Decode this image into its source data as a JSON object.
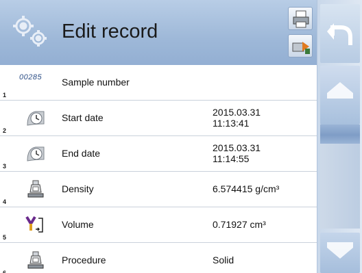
{
  "header": {
    "title": "Edit record"
  },
  "rows": [
    {
      "index": "1",
      "code": "00285",
      "label": "Sample number",
      "value": ""
    },
    {
      "index": "2",
      "label": "Start date",
      "value_line1": "2015.03.31",
      "value_line2": "11:13:41"
    },
    {
      "index": "3",
      "label": "End date",
      "value_line1": "2015.03.31",
      "value_line2": "11:14:55"
    },
    {
      "index": "4",
      "label": "Density",
      "value": "6.574415 g/cm³"
    },
    {
      "index": "5",
      "label": "Volume",
      "value": "0.71927 cm³"
    },
    {
      "index": "6",
      "label": "Procedure",
      "value": "Solid"
    }
  ],
  "icons": {
    "header": "gears-icon",
    "print": "printer-icon",
    "export": "export-icon",
    "back": "undo-arrow-icon",
    "scroll_up": "scroll-up-icon",
    "scroll_down": "scroll-down-icon",
    "date": "clock-icon",
    "density": "weight-balance-icon",
    "volume": "volume-icon",
    "procedure": "weight-balance-icon"
  },
  "colors": {
    "header_bg": "#9eb8d8",
    "sidebar_bg": "#c9d8ea",
    "sample_code": "#2d4f86"
  }
}
